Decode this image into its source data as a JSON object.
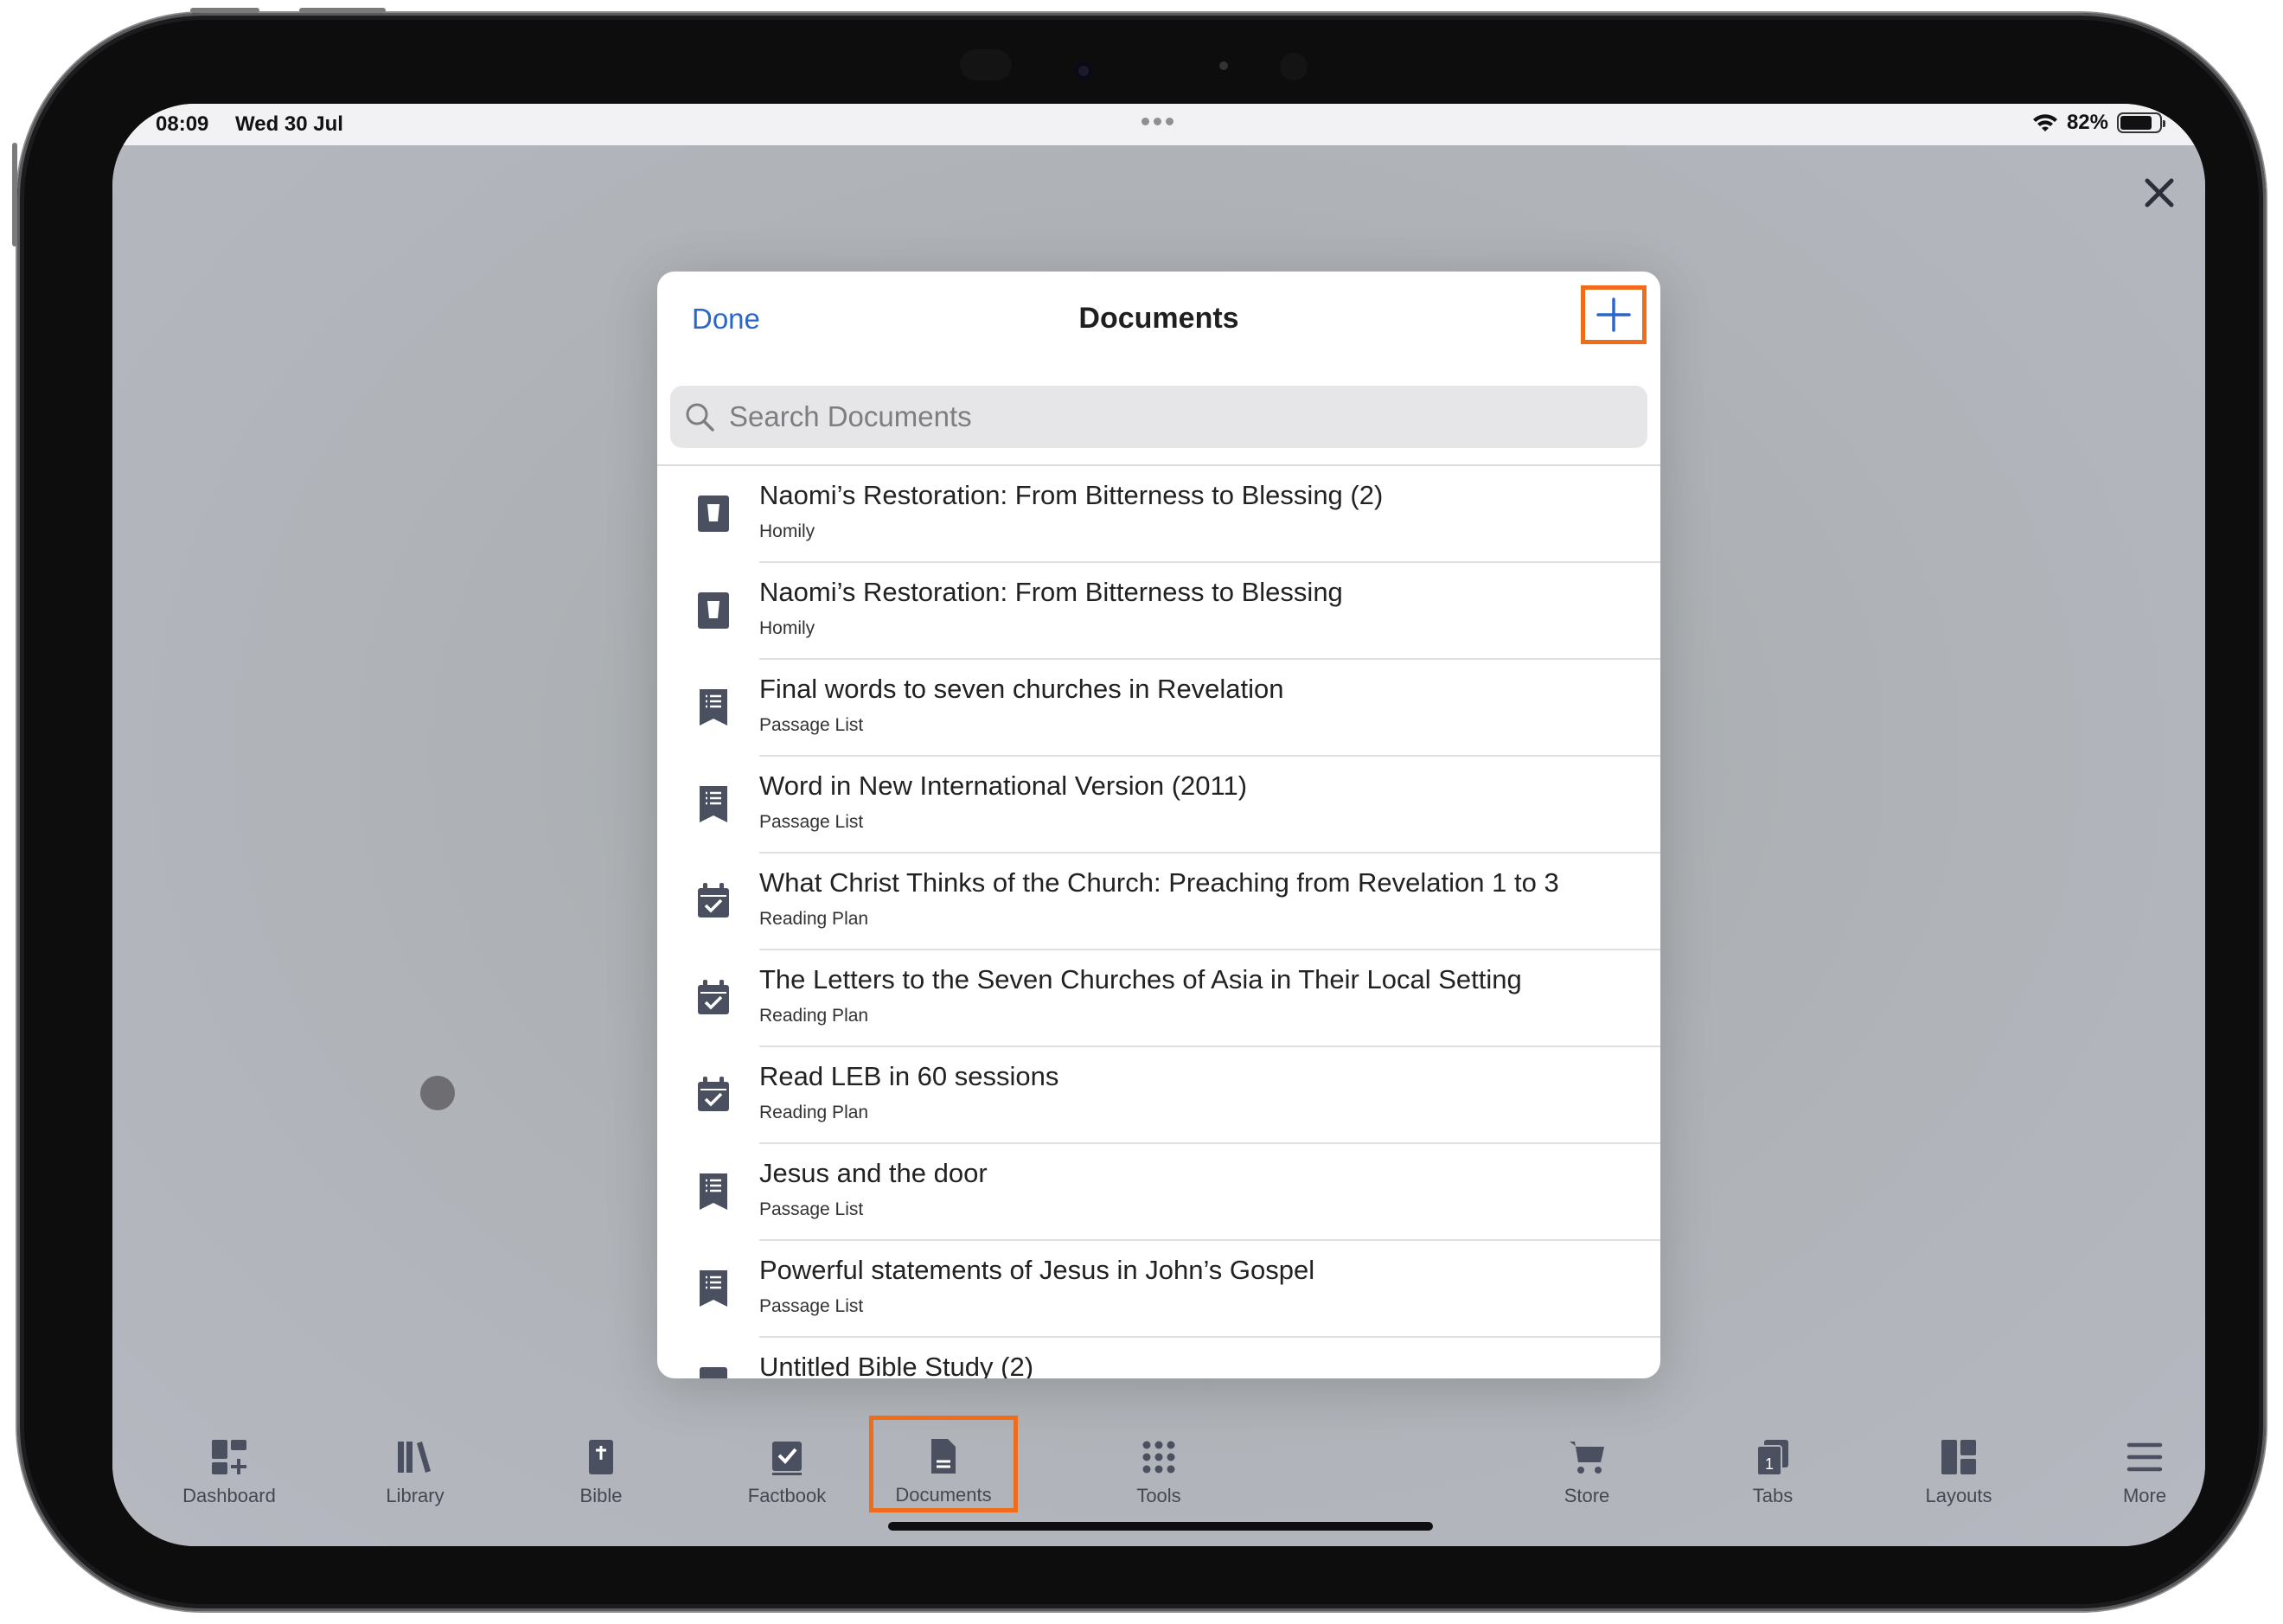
{
  "status_bar": {
    "time": "08:09",
    "date": "Wed 30 Jul",
    "battery": "82%",
    "battery_level": 0.82
  },
  "modal": {
    "done_label": "Done",
    "title": "Documents",
    "search_placeholder": "Search Documents",
    "items": [
      {
        "title": "Naomi’s Restoration: From Bitterness to Blessing (2)",
        "type": "Homily",
        "icon": "homily-icon"
      },
      {
        "title": "Naomi’s Restoration: From Bitterness to Blessing",
        "type": "Homily",
        "icon": "homily-icon"
      },
      {
        "title": "Final words to seven churches in Revelation",
        "type": "Passage List",
        "icon": "passage-list-icon"
      },
      {
        "title": "Word in New International Version (2011)",
        "type": "Passage List",
        "icon": "passage-list-icon"
      },
      {
        "title": "What Christ Thinks of the Church: Preaching from Revelation 1 to 3",
        "type": "Reading Plan",
        "icon": "reading-plan-icon"
      },
      {
        "title": "The Letters to the Seven Churches of Asia in Their Local Setting",
        "type": "Reading Plan",
        "icon": "reading-plan-icon"
      },
      {
        "title": "Read LEB in 60 sessions",
        "type": "Reading Plan",
        "icon": "reading-plan-icon"
      },
      {
        "title": "Jesus and the door",
        "type": "Passage List",
        "icon": "passage-list-icon"
      },
      {
        "title": "Powerful statements of Jesus in John’s Gospel",
        "type": "Passage List",
        "icon": "passage-list-icon"
      },
      {
        "title": "Untitled Bible Study (2)",
        "type": "",
        "icon": "bible-study-icon"
      }
    ]
  },
  "tab_bar": {
    "tabs": [
      {
        "label": "Dashboard",
        "icon": "dashboard-icon"
      },
      {
        "label": "Library",
        "icon": "library-icon"
      },
      {
        "label": "Bible",
        "icon": "bible-icon"
      },
      {
        "label": "Factbook",
        "icon": "factbook-icon"
      },
      {
        "label": "Documents",
        "icon": "documents-icon"
      },
      {
        "label": "Tools",
        "icon": "tools-icon"
      },
      {
        "label": "Store",
        "icon": "store-icon"
      },
      {
        "label": "Tabs",
        "icon": "tabs-icon",
        "badge": "1"
      },
      {
        "label": "Layouts",
        "icon": "layouts-icon"
      },
      {
        "label": "More",
        "icon": "more-icon"
      }
    ]
  },
  "colors": {
    "accent": "#2a67c9",
    "highlight": "#ef6c1a",
    "icon": "#4a5060"
  }
}
